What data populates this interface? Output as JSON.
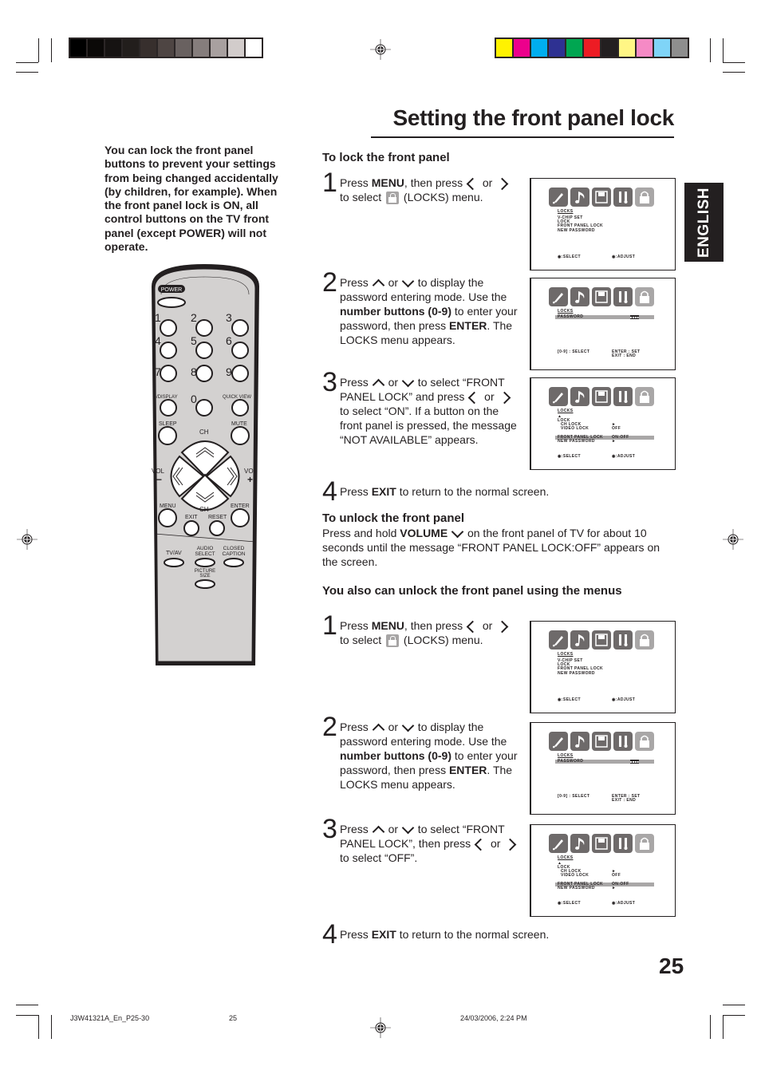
{
  "registration": {
    "grayscale_swatches": [
      "#000000",
      "#0b0908",
      "#161312",
      "#221e1c",
      "#372f2d",
      "#4e4543",
      "#696160",
      "#857d7c",
      "#a8a09f",
      "#d2cccb",
      "#ffffff"
    ],
    "color_swatches": [
      "#fff200",
      "#ec008c",
      "#00aeef",
      "#2e3192",
      "#00a651",
      "#ed1c24",
      "#231f20",
      "#fff685",
      "#f58ac5",
      "#7fd4f7",
      "#8e8e8e"
    ]
  },
  "page": {
    "title": "Setting the front panel lock",
    "language_tab": "ENGLISH",
    "page_number": "25",
    "intro": "You can lock the front panel buttons to prevent your settings from being changed accidentally (by children, for example). When the front panel lock is ON, all control buttons on the TV front panel (except POWER) will not operate."
  },
  "lock_section": {
    "heading": "To lock the front panel",
    "steps": [
      {
        "num": "1",
        "parts": [
          "Press ",
          "MENU",
          ", then press ",
          "<",
          " or ",
          ">",
          " to select ",
          "[lock]",
          " (LOCKS) menu."
        ]
      },
      {
        "num": "2",
        "parts": [
          "Press ",
          "^",
          " or ",
          "v",
          " to display the password entering mode. Use the ",
          "number buttons (0-9)",
          " to enter your password, then press ",
          "ENTER",
          ". The LOCKS menu appears."
        ]
      },
      {
        "num": "3",
        "parts": [
          "Press ",
          "^",
          " or ",
          "v",
          " to select “FRONT PANEL LOCK” and press ",
          "<",
          " or ",
          ">",
          " to select “ON”. If a button on the front panel is pressed, the message “NOT AVAILABLE” appears."
        ]
      },
      {
        "num": "4",
        "parts": [
          "Press ",
          "EXIT",
          " to return to the normal screen."
        ]
      }
    ]
  },
  "unlock_section": {
    "heading": "To unlock the front panel",
    "text_pre": "Press and hold ",
    "text_bold": "VOLUME",
    "text_post": " on the front panel of TV for about 10 seconds until the message “FRONT PANEL LOCK:OFF” appears on the screen."
  },
  "menu_unlock_section": {
    "heading": "You also can unlock the front panel using the menus",
    "steps": [
      {
        "num": "1",
        "parts": [
          "Press ",
          "MENU",
          ", then press ",
          "<",
          " or ",
          ">",
          " to select ",
          "[lock]",
          " (LOCKS) menu."
        ]
      },
      {
        "num": "2",
        "parts": [
          "Press ",
          "^",
          " or ",
          "v",
          " to display the password entering mode. Use the ",
          "number buttons (0-9)",
          " to enter your password, then press ",
          "ENTER",
          ". The LOCKS menu appears."
        ]
      },
      {
        "num": "3",
        "parts": [
          "Press ",
          "^",
          " or ",
          "v",
          " to select “FRONT PANEL LOCK”, then press ",
          "<",
          " or ",
          ">",
          " to select “OFF”."
        ]
      },
      {
        "num": "4",
        "parts": [
          "Press ",
          "EXIT",
          " to return to the normal screen."
        ]
      }
    ]
  },
  "screens": {
    "menu": {
      "title": "LOCKS",
      "items": [
        "V-CHIP SET",
        "LOCK",
        "FRONT PANEL LOCK",
        "NEW PASSWORD"
      ],
      "footer_left": ":SELECT",
      "footer_right": ":ADJUST"
    },
    "password": {
      "title": "LOCKS",
      "field": "PASSWORD",
      "mask": "■■■■",
      "footer_left": "[0-9] : SELECT",
      "footer_right_1": "ENTER : SET",
      "footer_right_2": "EXIT : END"
    },
    "lock_on": {
      "title": "LOCKS",
      "up": "▲",
      "lock": "LOCK",
      "ch_lock": "CH LOCK",
      "ch_val": "►",
      "video_lock": "VIDEO LOCK",
      "video_val": "OFF",
      "fpl": "FRONT PANEL LOCK",
      "fpl_val": "ON:OFF",
      "np": "NEW PASSWORD",
      "np_val": "►",
      "footer_left": ":SELECT",
      "footer_right": ":ADJUST"
    },
    "lock_off": {
      "title": "LOCKS",
      "up": "▲",
      "lock": "LOCK",
      "ch_lock": "CH LOCK",
      "ch_val": "►",
      "video_lock": "VIDEO LOCK",
      "video_val": "OFF",
      "fpl": "FRONT PANEL LOCK",
      "fpl_val": "ON:OFF",
      "np": "NEW PASSWORD",
      "np_val": "►",
      "footer_left": ":SELECT",
      "footer_right": ":ADJUST"
    }
  },
  "remote": {
    "power": "POWER",
    "digits": [
      "1",
      "2",
      "3",
      "4",
      "5",
      "6",
      "7",
      "8",
      "9",
      "0"
    ],
    "display": "-/DISPLAY",
    "quick_view": "QUICK VIEW",
    "sleep": "SLEEP",
    "mute": "MUTE",
    "ch": "CH",
    "vol": "VOL",
    "minus": "−",
    "plus": "+",
    "menu": "MENU",
    "enter": "ENTER",
    "exit": "EXIT",
    "reset": "RESET",
    "tvav": "TV/AV",
    "audio_select": "AUDIO SELECT",
    "closed_caption": "CLOSED CAPTION",
    "picture_size": "PICTURE SIZE"
  },
  "footer": {
    "file": "J3W41321A_En_P25-30",
    "page": "25",
    "timestamp": "24/03/2006, 2:24 PM"
  }
}
